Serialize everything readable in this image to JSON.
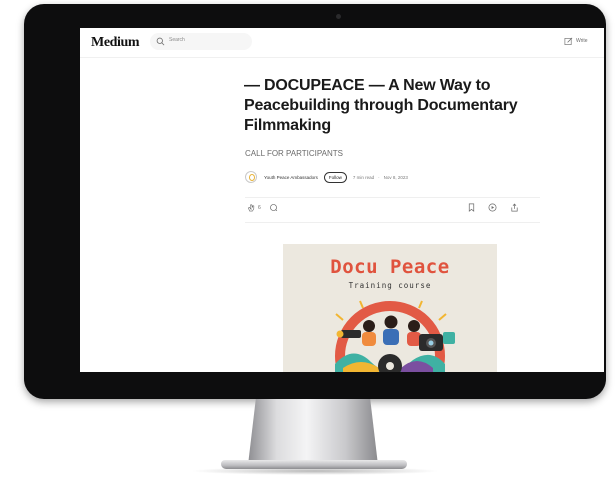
{
  "app": {
    "logo": "Medium",
    "search_placeholder": "Search",
    "write_label": "Write"
  },
  "article": {
    "title": "— DOCUPEACE — A New Way to Peacebuilding through Documentary Filmmaking",
    "subtitle": "CALL FOR PARTICIPANTS",
    "author": "Youth Peace Ambassadors",
    "follow_label": "Follow",
    "read_time": "7 min read",
    "separator": "·",
    "date": "Nov 8, 2023",
    "claps": "6"
  },
  "cover_image": {
    "title": "Docu Peace",
    "subtitle": "Training course",
    "colors": {
      "title": "#e0533e",
      "ring": "#e25a45",
      "background": "#ece8df"
    }
  },
  "icons": [
    "search-icon",
    "write-icon",
    "clap-icon",
    "comment-icon",
    "bookmark-icon",
    "listen-icon",
    "share-icon"
  ]
}
